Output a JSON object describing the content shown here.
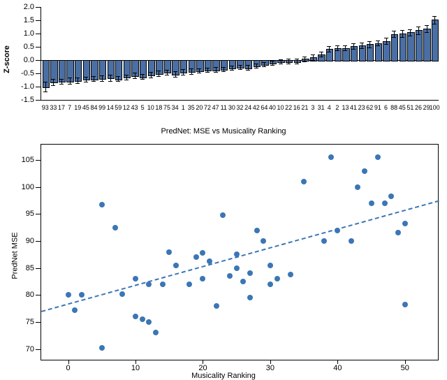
{
  "chart_data": [
    {
      "type": "bar",
      "ylabel": "Z-score",
      "xlabel": "",
      "ylim": [
        -1.5,
        2.0
      ],
      "yticks": [
        -1.5,
        -1.0,
        -0.5,
        0.0,
        0.5,
        1.0,
        1.5,
        2.0
      ],
      "categories": [
        "93",
        "33",
        "17",
        "7",
        "19",
        "45",
        "84",
        "99",
        "14",
        "59",
        "12",
        "43",
        "5",
        "10",
        "18",
        "75",
        "34",
        "1",
        "35",
        "20",
        "72",
        "47",
        "11",
        "30",
        "32",
        "24",
        "42",
        "64",
        "40",
        "10",
        "22",
        "16",
        "21",
        "3",
        "31",
        "4",
        "2",
        "13",
        "41",
        "23",
        "62",
        "91",
        "6",
        "88",
        "45",
        "51",
        "26",
        "29",
        "100"
      ],
      "values": [
        -1.0,
        -0.82,
        -0.8,
        -0.78,
        -0.76,
        -0.72,
        -0.7,
        -0.68,
        -0.66,
        -0.7,
        -0.64,
        -0.58,
        -0.62,
        -0.56,
        -0.5,
        -0.46,
        -0.52,
        -0.44,
        -0.42,
        -0.4,
        -0.38,
        -0.36,
        -0.34,
        -0.3,
        -0.26,
        -0.28,
        -0.22,
        -0.16,
        -0.1,
        -0.06,
        -0.04,
        -0.04,
        0.04,
        0.1,
        0.22,
        0.42,
        0.46,
        0.46,
        0.52,
        0.56,
        0.6,
        0.64,
        0.72,
        0.98,
        1.0,
        1.04,
        1.12,
        1.18,
        1.52
      ],
      "error": [
        0.18,
        0.12,
        0.1,
        0.12,
        0.1,
        0.1,
        0.1,
        0.1,
        0.12,
        0.1,
        0.1,
        0.1,
        0.1,
        0.1,
        0.1,
        0.1,
        0.1,
        0.1,
        0.1,
        0.08,
        0.08,
        0.1,
        0.08,
        0.08,
        0.08,
        0.1,
        0.08,
        0.08,
        0.08,
        0.08,
        0.08,
        0.1,
        0.08,
        0.1,
        0.1,
        0.1,
        0.1,
        0.1,
        0.1,
        0.1,
        0.12,
        0.1,
        0.12,
        0.12,
        0.12,
        0.12,
        0.14,
        0.14,
        0.14
      ]
    },
    {
      "type": "scatter",
      "title": "PredNet: MSE vs Musicality Ranking",
      "xlabel": "Musicality Ranking",
      "ylabel": "PredNet MSE",
      "xlim": [
        -4,
        55
      ],
      "ylim": [
        68,
        108
      ],
      "xticks": [
        0,
        10,
        20,
        30,
        40,
        50
      ],
      "yticks": [
        70,
        75,
        80,
        85,
        90,
        95,
        100,
        105
      ],
      "fit": {
        "x0": -4,
        "y0": 77.0,
        "x1": 55,
        "y1": 97.5
      },
      "points": [
        {
          "x": 0,
          "y": 80.0
        },
        {
          "x": 1,
          "y": 77.2
        },
        {
          "x": 2,
          "y": 80.0
        },
        {
          "x": 5,
          "y": 96.8
        },
        {
          "x": 5,
          "y": 70.2
        },
        {
          "x": 7,
          "y": 92.5
        },
        {
          "x": 8,
          "y": 80.2
        },
        {
          "x": 10,
          "y": 76.0
        },
        {
          "x": 10,
          "y": 83.0
        },
        {
          "x": 11,
          "y": 75.5
        },
        {
          "x": 12,
          "y": 75.0
        },
        {
          "x": 12,
          "y": 82.0
        },
        {
          "x": 13,
          "y": 73.0
        },
        {
          "x": 14,
          "y": 82.0
        },
        {
          "x": 15,
          "y": 88.0
        },
        {
          "x": 16,
          "y": 85.5
        },
        {
          "x": 18,
          "y": 82.0
        },
        {
          "x": 19,
          "y": 87.0
        },
        {
          "x": 20,
          "y": 87.8
        },
        {
          "x": 20,
          "y": 83.0
        },
        {
          "x": 21,
          "y": 86.2
        },
        {
          "x": 22,
          "y": 78.0
        },
        {
          "x": 23,
          "y": 94.8
        },
        {
          "x": 24,
          "y": 83.5
        },
        {
          "x": 25,
          "y": 87.5
        },
        {
          "x": 25,
          "y": 85.0
        },
        {
          "x": 26,
          "y": 82.5
        },
        {
          "x": 27,
          "y": 84.0
        },
        {
          "x": 27,
          "y": 79.5
        },
        {
          "x": 28,
          "y": 92.0
        },
        {
          "x": 29,
          "y": 90.0
        },
        {
          "x": 30,
          "y": 82.0
        },
        {
          "x": 30,
          "y": 85.5
        },
        {
          "x": 31,
          "y": 83.0
        },
        {
          "x": 33,
          "y": 83.8
        },
        {
          "x": 35,
          "y": 101.0
        },
        {
          "x": 38,
          "y": 90.0
        },
        {
          "x": 39,
          "y": 105.5
        },
        {
          "x": 40,
          "y": 92.0
        },
        {
          "x": 42,
          "y": 90.0
        },
        {
          "x": 43,
          "y": 100.0
        },
        {
          "x": 44,
          "y": 103.0
        },
        {
          "x": 45,
          "y": 97.0
        },
        {
          "x": 46,
          "y": 105.5
        },
        {
          "x": 47,
          "y": 97.0
        },
        {
          "x": 48,
          "y": 98.3
        },
        {
          "x": 49,
          "y": 91.5
        },
        {
          "x": 50,
          "y": 93.2
        },
        {
          "x": 50,
          "y": 78.2
        }
      ]
    }
  ]
}
